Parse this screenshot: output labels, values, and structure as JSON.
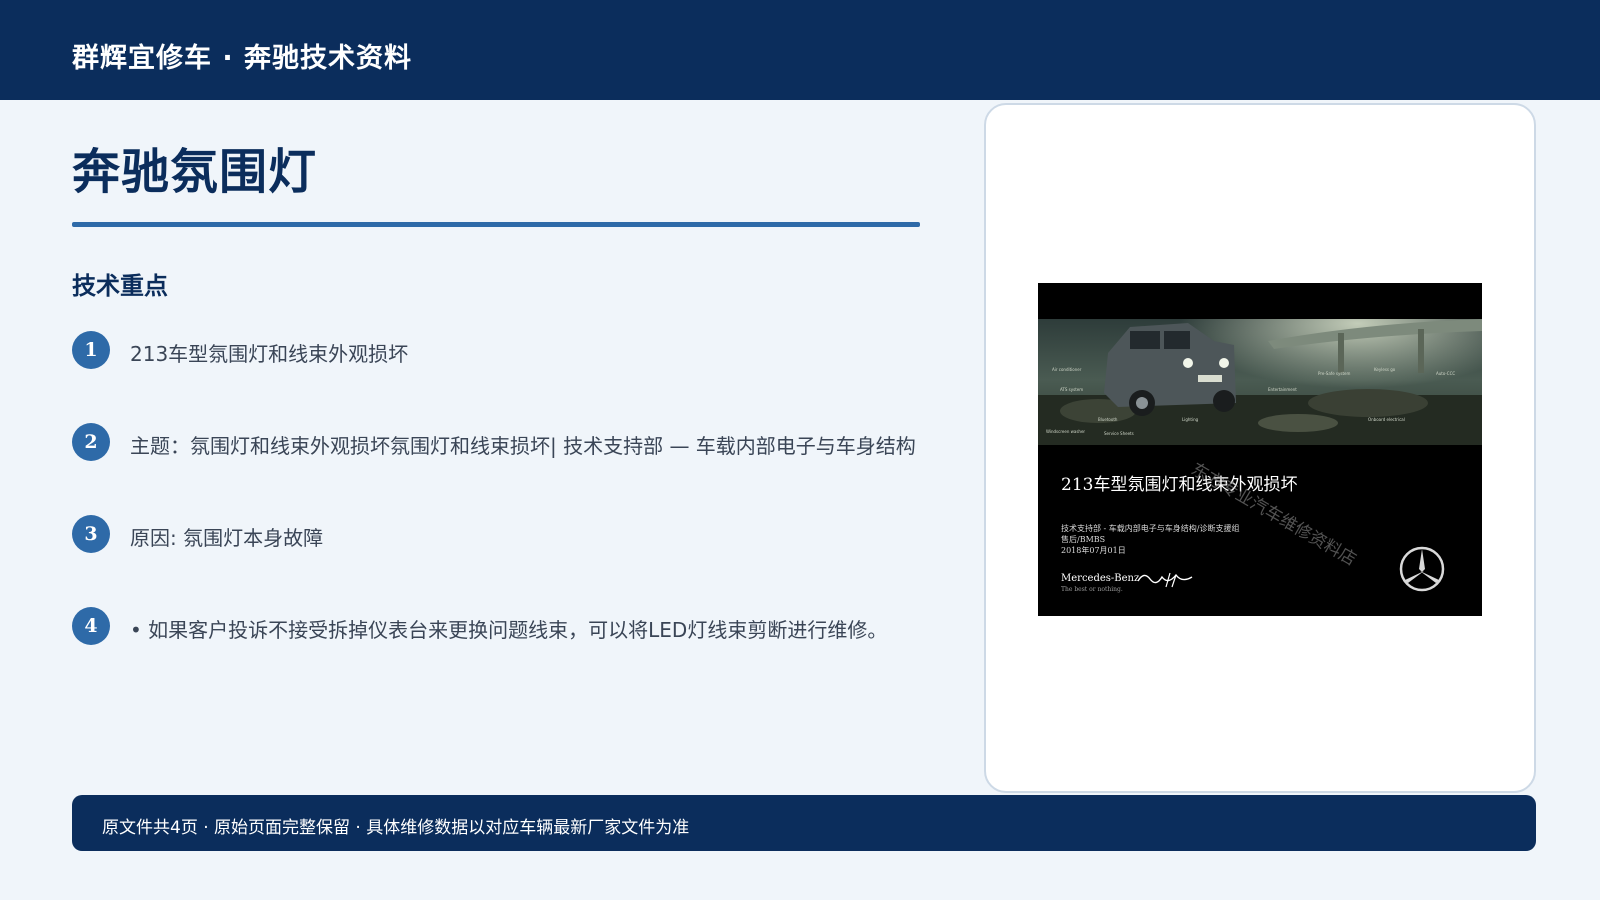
{
  "header": {
    "title": "群辉宜修车 · 奔驰技术资料"
  },
  "page": {
    "title": "奔驰氛围灯",
    "section_heading": "技术重点",
    "points": [
      {
        "num": "1",
        "text": "213车型氛围灯和线束外观损坏"
      },
      {
        "num": "2",
        "text": "主题：氛围灯和线束外观损坏氛围灯和线束损坏| 技术支持部 — 车载内部电子与车身结构"
      },
      {
        "num": "3",
        "text": "原因: 氛围灯本身故障"
      },
      {
        "num": "4",
        "text": "• 如果客户投诉不接受拆掉仪表台来更换问题线束，可以将LED灯线束剪断进行维修。"
      }
    ]
  },
  "slide": {
    "heading": "213车型氛围灯和线束外观损坏",
    "sub_lines": [
      "技术支持部 - 车载内部电子与车身结构/诊断支援组",
      "售后/BMBS",
      "2018年07月01日"
    ],
    "brand": "Mercedes-Benz",
    "tagline": "The best or nothing.",
    "watermark": "东方专业汽车维修资料店",
    "photo_icon": "suv-vehicle-photo",
    "star_icon": "mercedes-star-icon"
  },
  "footer": {
    "text": "原文件共4页 · 原始页面完整保留 · 具体维修数据以对应车辆最新厂家文件为准"
  },
  "colors": {
    "primary": "#0b2d5c",
    "accent": "#2e6aa8",
    "background": "#f0f5fa"
  }
}
